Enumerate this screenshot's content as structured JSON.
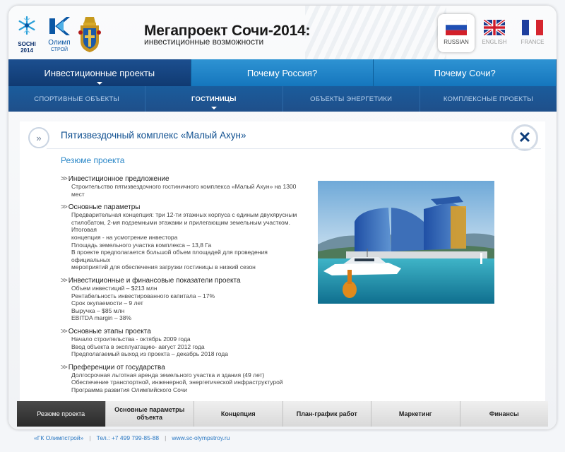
{
  "header": {
    "sochi_logo_text": "SOCHI 2014",
    "olimp_logo_text": "Олимп",
    "olimp_logo_sub": "СТРОЙ",
    "title": "Мегапроект Сочи-2014:",
    "subtitle": "инвестиционные возможности"
  },
  "languages": [
    {
      "label": "RUSSIAN",
      "active": true
    },
    {
      "label": "ENGLISH",
      "active": false
    },
    {
      "label": "FRANCE",
      "active": false
    }
  ],
  "nav_main": [
    {
      "label": "Инвестиционные проекты",
      "active": true
    },
    {
      "label": "Почему Россия?",
      "active": false
    },
    {
      "label": "Почему Сочи?",
      "active": false
    }
  ],
  "nav_sub": [
    {
      "label": "СПОРТИВНЫЕ ОБЪЕКТЫ",
      "active": false
    },
    {
      "label": "ГОСТИНИЦЫ",
      "active": true
    },
    {
      "label": "ОБЪЕКТЫ ЭНЕРГЕТИКИ",
      "active": false
    },
    {
      "label": "КОМПЛЕКСНЫЕ ПРОЕКТЫ",
      "active": false
    }
  ],
  "content": {
    "title": "Пятизвездочный комплекс «Малый Ахун»",
    "section_title": "Резюме проекта",
    "blocks": [
      {
        "heading": "Инвестиционное предложение",
        "lines": [
          "Строительство пятизвездочного гостиничного комплекса «Малый Ахун» на 1300 мест"
        ]
      },
      {
        "heading": "Основные параметры",
        "lines": [
          "Предварительная концепция: три 12-ти этажных корпуса с единым двухярусным",
          "стилобатом, 2-мя подземными этажами и прилегающим земельным участком. Итоговая",
          "концепция - на усмотрение инвестора",
          "Площадь земельного участка комплекса – 13,8 Га",
          "В проекте предполагается большой объем площадей для проведения официальных",
          "мероприятий для обеспечения загрузки гостиницы в низкий сезон"
        ]
      },
      {
        "heading": "Инвестиционные и финансовые показатели проекта",
        "lines": [
          "Объем инвестиций – $213 млн",
          "Рентабельность инвестированного капитала – 17%",
          "Срок окупаемости – 9 лет",
          "Выручка – $85 млн",
          "EBITDA margin – 38%"
        ]
      },
      {
        "heading": "Основные этапы проекта",
        "lines": [
          "Начало строительства - октябрь 2009 года",
          "Ввод объекта в эксплуатацию- август 2012 года",
          "Предполагаемый выход из проекта – декабрь 2018 года"
        ]
      },
      {
        "heading": "Преференции от государства",
        "lines": [
          "Долгосрочная льготная аренда земельного участка и здания (49 лет)",
          "Обеспечение  транспортной, инженерной, энергетической инфраструктурой",
          "Программа развития Олимпийского Сочи"
        ]
      }
    ]
  },
  "tabs": [
    {
      "label": "Резюме проекта",
      "active": true
    },
    {
      "label": "Основные параметры объекта",
      "active": false
    },
    {
      "label": "Концепция",
      "active": false
    },
    {
      "label": "План-график работ",
      "active": false
    },
    {
      "label": "Маркетинг",
      "active": false
    },
    {
      "label": "Финансы",
      "active": false
    }
  ],
  "footer": {
    "company": "«ГК Олимпстрой»",
    "phone": "Тел.: +7 499 799-85-88",
    "site": "www.sc-olympstroy.ru"
  },
  "colors": {
    "nav_blue": "#1576bd",
    "nav_active": "#103a72",
    "title_blue": "#0d4e8f",
    "section_blue": "#2c88c8"
  }
}
